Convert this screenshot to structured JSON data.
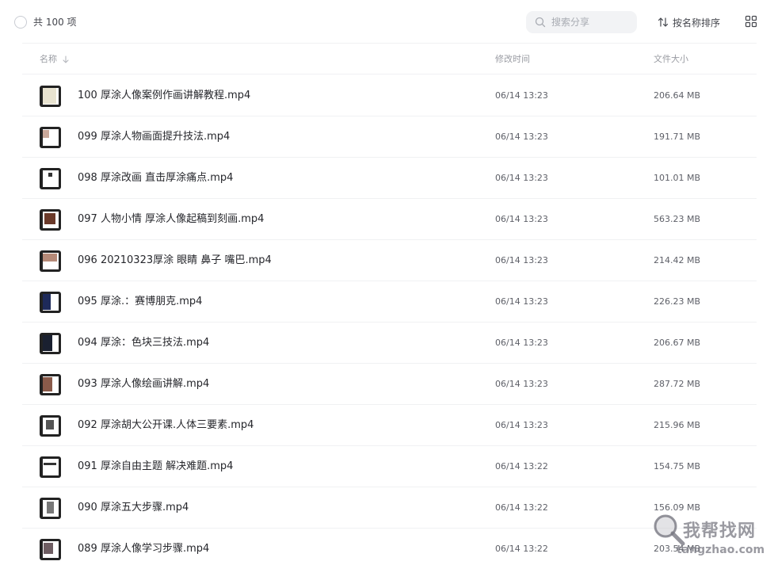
{
  "toolbar": {
    "count_label": "共 100 项",
    "search_placeholder": "搜索分享",
    "sort_label": "按名称排序"
  },
  "header": {
    "name": "名称",
    "modified": "修改时间",
    "size": "文件大小"
  },
  "files": [
    {
      "name": "100 厚涂人像案例作画讲解教程.mp4",
      "modified": "06/14 13:23",
      "size": "206.64 MB"
    },
    {
      "name": "099 厚涂人物画面提升技法.mp4",
      "modified": "06/14 13:23",
      "size": "191.71 MB"
    },
    {
      "name": "098 厚涂改画 直击厚涂痛点.mp4",
      "modified": "06/14 13:23",
      "size": "101.01 MB"
    },
    {
      "name": "097 人物小情 厚涂人像起稿到刻画.mp4",
      "modified": "06/14 13:23",
      "size": "563.23 MB"
    },
    {
      "name": "096 20210323厚涂 眼睛 鼻子 嘴巴.mp4",
      "modified": "06/14 13:23",
      "size": "214.42 MB"
    },
    {
      "name": "095 厚涂.：赛博朋克.mp4",
      "modified": "06/14 13:23",
      "size": "226.23 MB"
    },
    {
      "name": "094 厚涂：色块三技法.mp4",
      "modified": "06/14 13:23",
      "size": "206.67 MB"
    },
    {
      "name": "093 厚涂人像绘画讲解.mp4",
      "modified": "06/14 13:23",
      "size": "287.72 MB"
    },
    {
      "name": "092 厚涂胡大公开课.人体三要素.mp4",
      "modified": "06/14 13:23",
      "size": "215.96 MB"
    },
    {
      "name": "091 厚涂自由主题 解决难题.mp4",
      "modified": "06/14 13:22",
      "size": "154.75 MB"
    },
    {
      "name": "090 厚涂五大步骤.mp4",
      "modified": "06/14 13:22",
      "size": "156.09 MB"
    },
    {
      "name": "089 厚涂人像学习步骤.mp4",
      "modified": "06/14 13:22",
      "size": "203.54 MB"
    }
  ],
  "watermark": {
    "text": "我帮找网",
    "url": "tangzhao.com"
  }
}
